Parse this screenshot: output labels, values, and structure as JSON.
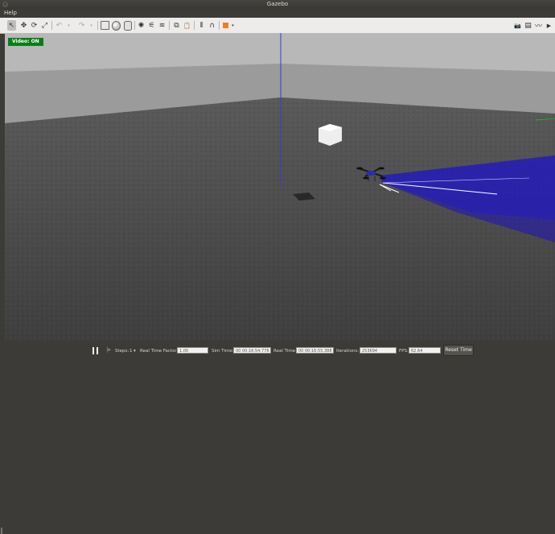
{
  "window": {
    "title": "Gazebo",
    "close_glyph": "×"
  },
  "menu": {
    "items": [
      "Help"
    ]
  },
  "toolbar": {
    "left_tools": [
      {
        "icon": "select-arrow-icon",
        "glyph": "↖"
      },
      {
        "icon": "translate-icon",
        "glyph": "✥"
      },
      {
        "icon": "rotate-icon",
        "glyph": "⟳"
      },
      {
        "icon": "scale-icon",
        "glyph": "⤢"
      },
      {
        "icon": "undo-icon",
        "glyph": "↶"
      },
      {
        "icon": "redo-icon",
        "glyph": "↷"
      },
      {
        "icon": "box-shape-icon",
        "glyph": ""
      },
      {
        "icon": "sphere-shape-icon",
        "glyph": ""
      },
      {
        "icon": "cylinder-shape-icon",
        "glyph": ""
      },
      {
        "icon": "point-light-icon",
        "glyph": "✺"
      },
      {
        "icon": "spot-light-icon",
        "glyph": "⚟"
      },
      {
        "icon": "directional-light-icon",
        "glyph": "≋"
      },
      {
        "icon": "copy-icon",
        "glyph": "⧉"
      },
      {
        "icon": "paste-icon",
        "glyph": "📋"
      },
      {
        "icon": "align-icon",
        "glyph": "⫴"
      },
      {
        "icon": "snap-icon",
        "glyph": "∩"
      },
      {
        "icon": "change-view-icon",
        "glyph": ""
      }
    ],
    "right_tools": [
      {
        "icon": "screenshot-camera-icon",
        "glyph": "📷"
      },
      {
        "icon": "log-icon",
        "glyph": "▤"
      },
      {
        "icon": "plot-icon",
        "glyph": "〰"
      },
      {
        "icon": "video-record-icon",
        "glyph": "▶"
      }
    ]
  },
  "viewport": {
    "video_badge": "Video: ON",
    "colors": {
      "sky": "#a7a7a7",
      "ground": "#4a4a4a",
      "laser": "#1e14c8",
      "z_axis": "#3a3ad0",
      "y_axis": "#2ea62e",
      "drone": "#2a2a2a"
    }
  },
  "status": {
    "steps_label": "Steps:",
    "steps_value": "1",
    "real_time_factor_label": "Real Time Factor:",
    "real_time_factor_value": "1.00",
    "sim_time_label": "Sim Time:",
    "sim_time_value": "00 00:16:54.776",
    "real_time_label": "Real Time:",
    "real_time_value": "00 00:16:55.388",
    "iterations_label": "Iterations:",
    "iterations_value": "253694",
    "fps_label": "FPS:",
    "fps_value": "62.64",
    "reset_label": "Reset Time"
  }
}
